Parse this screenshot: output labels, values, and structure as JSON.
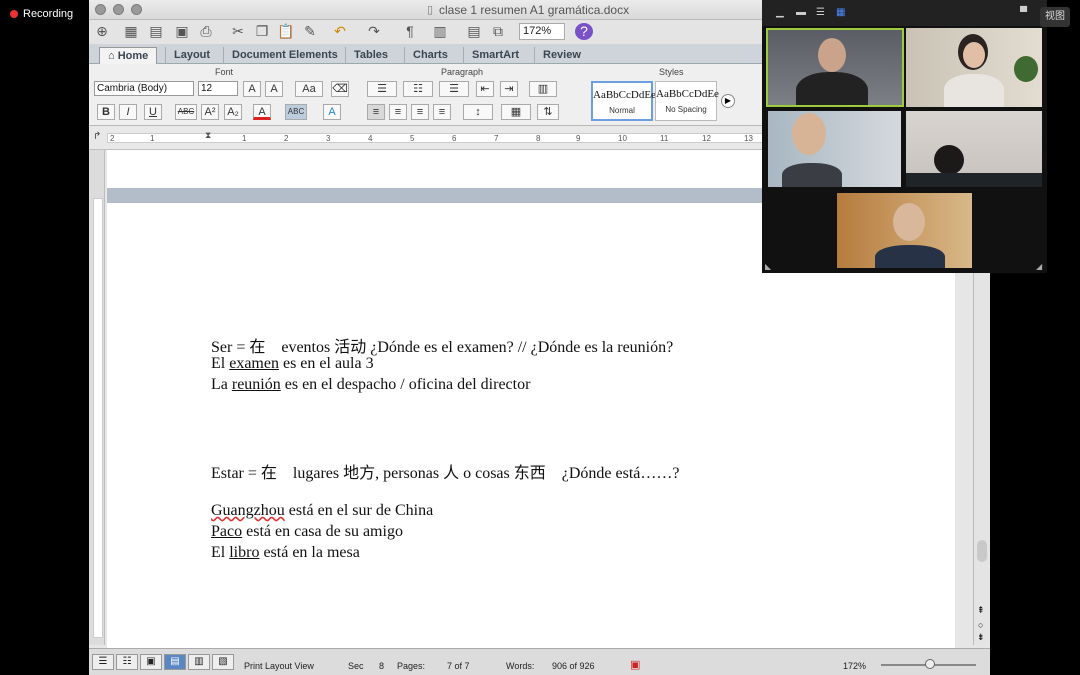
{
  "recording_label": "Recording",
  "view_label": "视图",
  "window": {
    "title": "clase 1 resumen A1 gramática.docx"
  },
  "toolbar": {
    "zoom": "172%"
  },
  "tabs": [
    {
      "label": "Home"
    },
    {
      "label": "Layout"
    },
    {
      "label": "Document Elements"
    },
    {
      "label": "Tables"
    },
    {
      "label": "Charts"
    },
    {
      "label": "SmartArt"
    },
    {
      "label": "Review"
    }
  ],
  "ribbon": {
    "font_group": "Font",
    "paragraph_group": "Paragraph",
    "styles_group": "Styles",
    "font_name": "Cambria (Body)",
    "font_size": "12",
    "styles": [
      {
        "preview": "AaBbCcDdEe",
        "name": "Normal"
      },
      {
        "preview": "AaBbCcDdEe",
        "name": "No Spacing"
      }
    ]
  },
  "ruler_numbers": [
    "2",
    "1",
    "1",
    "2",
    "3",
    "4",
    "5",
    "6",
    "7",
    "8",
    "9",
    "10",
    "11",
    "12",
    "13"
  ],
  "document": {
    "ser_a": "Ser = 在    eventos 活动 ¿Dónde es el examen? // ¿Dónde es la reunión?",
    "ser_b1": "El ",
    "ser_b2": "examen",
    "ser_b3": " es en el aula 3",
    "ser_c1": "La ",
    "ser_c2": "reunión",
    "ser_c3": " es en el despacho / oficina del director",
    "estar_a": "Estar = 在    lugares 地方, personas 人 o cosas 东西    ¿Dónde está……?",
    "estar_b1": "Guangzhou",
    "estar_b2": " está en el sur de China",
    "estar_c1": "Paco",
    "estar_c2": " está en casa de su amigo",
    "estar_d1": "El ",
    "estar_d2": "libro",
    "estar_d3": " está en la mesa"
  },
  "status": {
    "view": "Print Layout View",
    "sec_label": "Sec",
    "sec": "8",
    "pages_label": "Pages:",
    "pages": "7 of 7",
    "words_label": "Words:",
    "words": "906 of 926",
    "zoom": "172%"
  }
}
